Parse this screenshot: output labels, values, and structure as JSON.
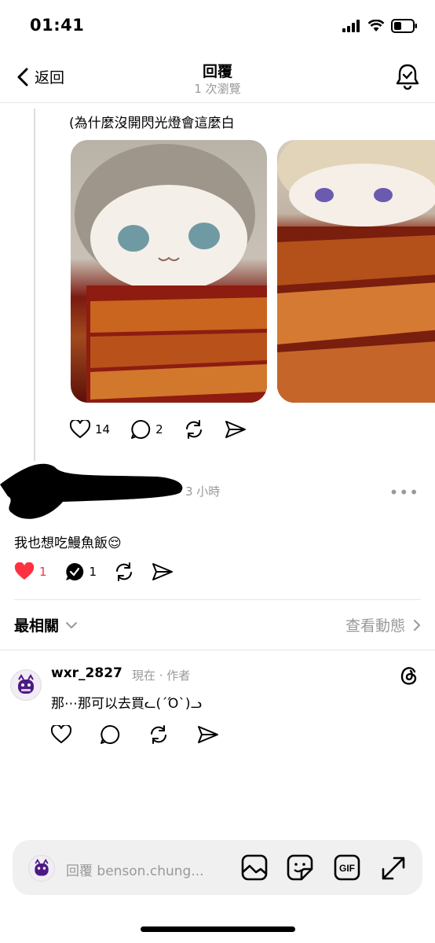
{
  "status": {
    "time": "01:41"
  },
  "nav": {
    "back_label": "返回",
    "title": "回覆",
    "subtitle": "1 次瀏覽"
  },
  "parent_post": {
    "caption": "(為什麼沒開閃光燈會這麼白",
    "likes": "14",
    "replies": "2"
  },
  "reply_post": {
    "time": "3 小時",
    "more": "•••",
    "text": "我也想吃鰻魚飯😌",
    "likes": "1",
    "replies": "1"
  },
  "sort": {
    "label": "最相關",
    "activity_label": "查看動態"
  },
  "comment": {
    "username": "wxr_2827",
    "meta": "現在 · 作者",
    "text": "那⋯那可以去買ᓚ(´Ό`)ᓗ"
  },
  "composer": {
    "placeholder": "回覆 benson.chung..."
  },
  "colors": {
    "like_red": "#ff3040",
    "muted": "#999999"
  }
}
